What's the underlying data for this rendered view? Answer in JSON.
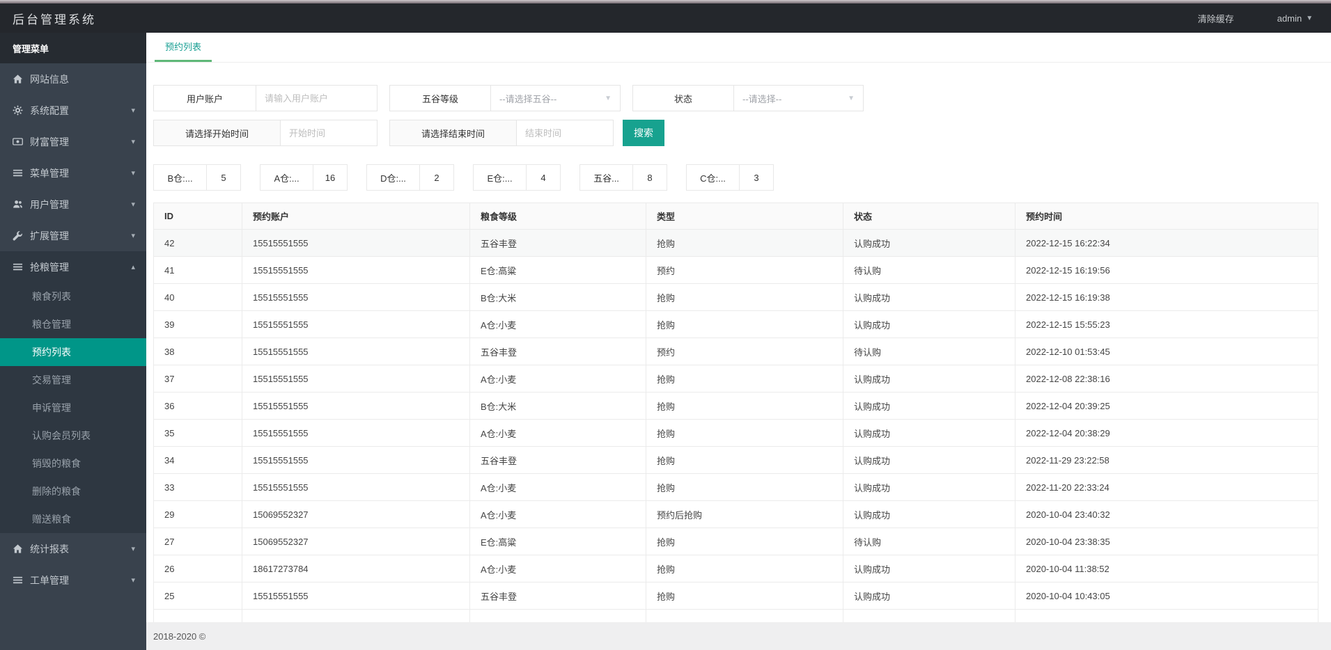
{
  "topbar": {
    "title": "后台管理系统",
    "clear_cache_label": "清除缓存",
    "user_label": "admin"
  },
  "sidebar": {
    "header": "管理菜单",
    "items": [
      {
        "label": "网站信息",
        "name": "site-info",
        "icon": "home-icon"
      },
      {
        "label": "系统配置",
        "name": "system-config",
        "icon": "gear-icon",
        "collapsible": true
      },
      {
        "label": "财富管理",
        "name": "wealth-management",
        "icon": "money-icon",
        "collapsible": true
      },
      {
        "label": "菜单管理",
        "name": "menu-management",
        "icon": "list-icon",
        "collapsible": true
      },
      {
        "label": "用户管理",
        "name": "user-management",
        "icon": "users-icon",
        "collapsible": true
      },
      {
        "label": "扩展管理",
        "name": "extension-management",
        "icon": "wrench-icon",
        "collapsible": true
      },
      {
        "label": "抢粮管理",
        "name": "grain-grab-management",
        "icon": "list-icon",
        "collapsible": true,
        "expanded": true,
        "children": [
          {
            "label": "粮食列表",
            "name": "grain-list"
          },
          {
            "label": "粮仓管理",
            "name": "granary-management"
          },
          {
            "label": "预约列表",
            "name": "reservation-list",
            "active": true
          },
          {
            "label": "交易管理",
            "name": "trade-management"
          },
          {
            "label": "申诉管理",
            "name": "appeal-management"
          },
          {
            "label": "认购会员列表",
            "name": "subscription-member-list"
          },
          {
            "label": "销毁的粮食",
            "name": "destroyed-grain"
          },
          {
            "label": "删除的粮食",
            "name": "deleted-grain"
          },
          {
            "label": "赠送粮食",
            "name": "gift-grain"
          }
        ]
      },
      {
        "label": "统计报表",
        "name": "statistics-report",
        "icon": "home-icon",
        "collapsible": true
      },
      {
        "label": "工单管理",
        "name": "work-order-management",
        "icon": "list-icon",
        "collapsible": true
      }
    ]
  },
  "tabs": [
    {
      "label": "预约列表",
      "active": true
    }
  ],
  "filters": {
    "account_label": "用户账户",
    "account_placeholder": "请输入用户账户",
    "grain_label": "五谷等级",
    "grain_placeholder": "--请选择五谷--",
    "status_label": "状态",
    "status_placeholder": "--请选择--",
    "start_label": "请选择开始时间",
    "start_placeholder": "开始时间",
    "end_label": "请选择结束时间",
    "end_placeholder": "结束时间",
    "search_label": "搜索"
  },
  "counters": [
    {
      "label": "B仓:...",
      "value": "5"
    },
    {
      "label": "A仓:...",
      "value": "16"
    },
    {
      "label": "D仓:...",
      "value": "2"
    },
    {
      "label": "E仓:...",
      "value": "4"
    },
    {
      "label": "五谷...",
      "value": "8"
    },
    {
      "label": "C仓:...",
      "value": "3"
    }
  ],
  "table": {
    "columns": [
      "ID",
      "预约账户",
      "粮食等级",
      "类型",
      "状态",
      "预约时间"
    ],
    "rows": [
      [
        "42",
        "15515551555",
        "五谷丰登",
        "抢购",
        "认购成功",
        "2022-12-15 16:22:34"
      ],
      [
        "41",
        "15515551555",
        "E仓:高粱",
        "预约",
        "待认购",
        "2022-12-15 16:19:56"
      ],
      [
        "40",
        "15515551555",
        "B仓:大米",
        "抢购",
        "认购成功",
        "2022-12-15 16:19:38"
      ],
      [
        "39",
        "15515551555",
        "A仓:小麦",
        "抢购",
        "认购成功",
        "2022-12-15 15:55:23"
      ],
      [
        "38",
        "15515551555",
        "五谷丰登",
        "预约",
        "待认购",
        "2022-12-10 01:53:45"
      ],
      [
        "37",
        "15515551555",
        "A仓:小麦",
        "抢购",
        "认购成功",
        "2022-12-08 22:38:16"
      ],
      [
        "36",
        "15515551555",
        "B仓:大米",
        "抢购",
        "认购成功",
        "2022-12-04 20:39:25"
      ],
      [
        "35",
        "15515551555",
        "A仓:小麦",
        "抢购",
        "认购成功",
        "2022-12-04 20:38:29"
      ],
      [
        "34",
        "15515551555",
        "五谷丰登",
        "抢购",
        "认购成功",
        "2022-11-29 23:22:58"
      ],
      [
        "33",
        "15515551555",
        "A仓:小麦",
        "抢购",
        "认购成功",
        "2022-11-20 22:33:24"
      ],
      [
        "29",
        "15069552327",
        "A仓:小麦",
        "预约后抢购",
        "认购成功",
        "2020-10-04 23:40:32"
      ],
      [
        "27",
        "15069552327",
        "E仓:高粱",
        "抢购",
        "待认购",
        "2020-10-04 23:38:35"
      ],
      [
        "26",
        "18617273784",
        "A仓:小麦",
        "抢购",
        "认购成功",
        "2020-10-04 11:38:52"
      ],
      [
        "25",
        "15515551555",
        "五谷丰登",
        "抢购",
        "认购成功",
        "2020-10-04 10:43:05"
      ]
    ]
  },
  "footer": {
    "copyright": "2018-2020 ©"
  },
  "colors": {
    "accent_teal": "#009688",
    "tab_text": "#1aa094",
    "tab_underline": "#5FB878",
    "search_button": "#17a28f",
    "topbar_bg": "#24272c",
    "sidebar_bg": "#39424d",
    "sidebar_section_bg": "#2e3741",
    "footer_bg": "#efeff0"
  }
}
